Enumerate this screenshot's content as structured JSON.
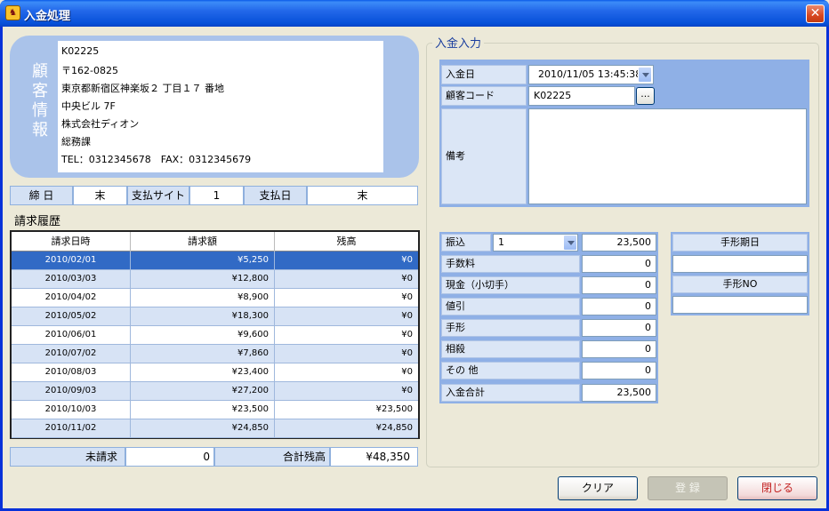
{
  "window": {
    "title": "入金処理",
    "close_glyph": "✕",
    "icon": "app-icon"
  },
  "customer": {
    "side_label": [
      "顧",
      "客",
      "情",
      "報"
    ],
    "lines": [
      "K02225",
      "〒162-0825",
      "東京都新宿区神楽坂２ 丁目１７ 番地",
      "中央ビル 7F",
      "株式会社ディオン",
      "総務課",
      "TEL：0312345678　FAX：0312345679"
    ]
  },
  "terms": {
    "close_label": "締 日",
    "close_value": "末",
    "site_label": "支払サイト",
    "site_value": "1",
    "payday_label": "支払日",
    "payday_value": "末"
  },
  "history": {
    "title": "請求履歴",
    "columns": [
      "請求日時",
      "請求額",
      "残高"
    ],
    "rows": [
      [
        "2010/02/01",
        "¥5,250",
        "¥0"
      ],
      [
        "2010/03/03",
        "¥12,800",
        "¥0"
      ],
      [
        "2010/04/02",
        "¥8,900",
        "¥0"
      ],
      [
        "2010/05/02",
        "¥18,300",
        "¥0"
      ],
      [
        "2010/06/01",
        "¥9,600",
        "¥0"
      ],
      [
        "2010/07/02",
        "¥7,860",
        "¥0"
      ],
      [
        "2010/08/03",
        "¥23,400",
        "¥0"
      ],
      [
        "2010/09/03",
        "¥27,200",
        "¥0"
      ],
      [
        "2010/10/03",
        "¥23,500",
        "¥23,500"
      ],
      [
        "2010/11/02",
        "¥24,850",
        "¥24,850"
      ]
    ],
    "selected_index": 0
  },
  "summary": {
    "unbilled_label": "未請求",
    "unbilled_value": "0",
    "total_label": "合計残高",
    "total_value": "¥48,350"
  },
  "entry": {
    "group_title": "入金入力",
    "date_label": "入金日",
    "date_value": "2010/11/05 13:45:38",
    "customer_code_label": "顧客コード",
    "customer_code_value": "K02225",
    "browse_label": "...",
    "remarks_label": "備考",
    "remarks_value": ""
  },
  "payment": {
    "transfer_label": "振込",
    "transfer_option": "1",
    "transfer_value": "23,500",
    "rows": [
      {
        "label": "手数料",
        "value": "0"
      },
      {
        "label": "現金（小切手）",
        "value": "0"
      },
      {
        "label": "値引",
        "value": "0"
      },
      {
        "label": "手形",
        "value": "0"
      },
      {
        "label": "相殺",
        "value": "0"
      },
      {
        "label": "その 他",
        "value": "0"
      }
    ],
    "total_label": "入金合計",
    "total_value": "23,500"
  },
  "note": {
    "due_label": "手形期日",
    "due_value": "",
    "no_label": "手形NO",
    "no_value": ""
  },
  "buttons": {
    "clear": "クリア",
    "register": "登 録",
    "close": "閉じる"
  }
}
